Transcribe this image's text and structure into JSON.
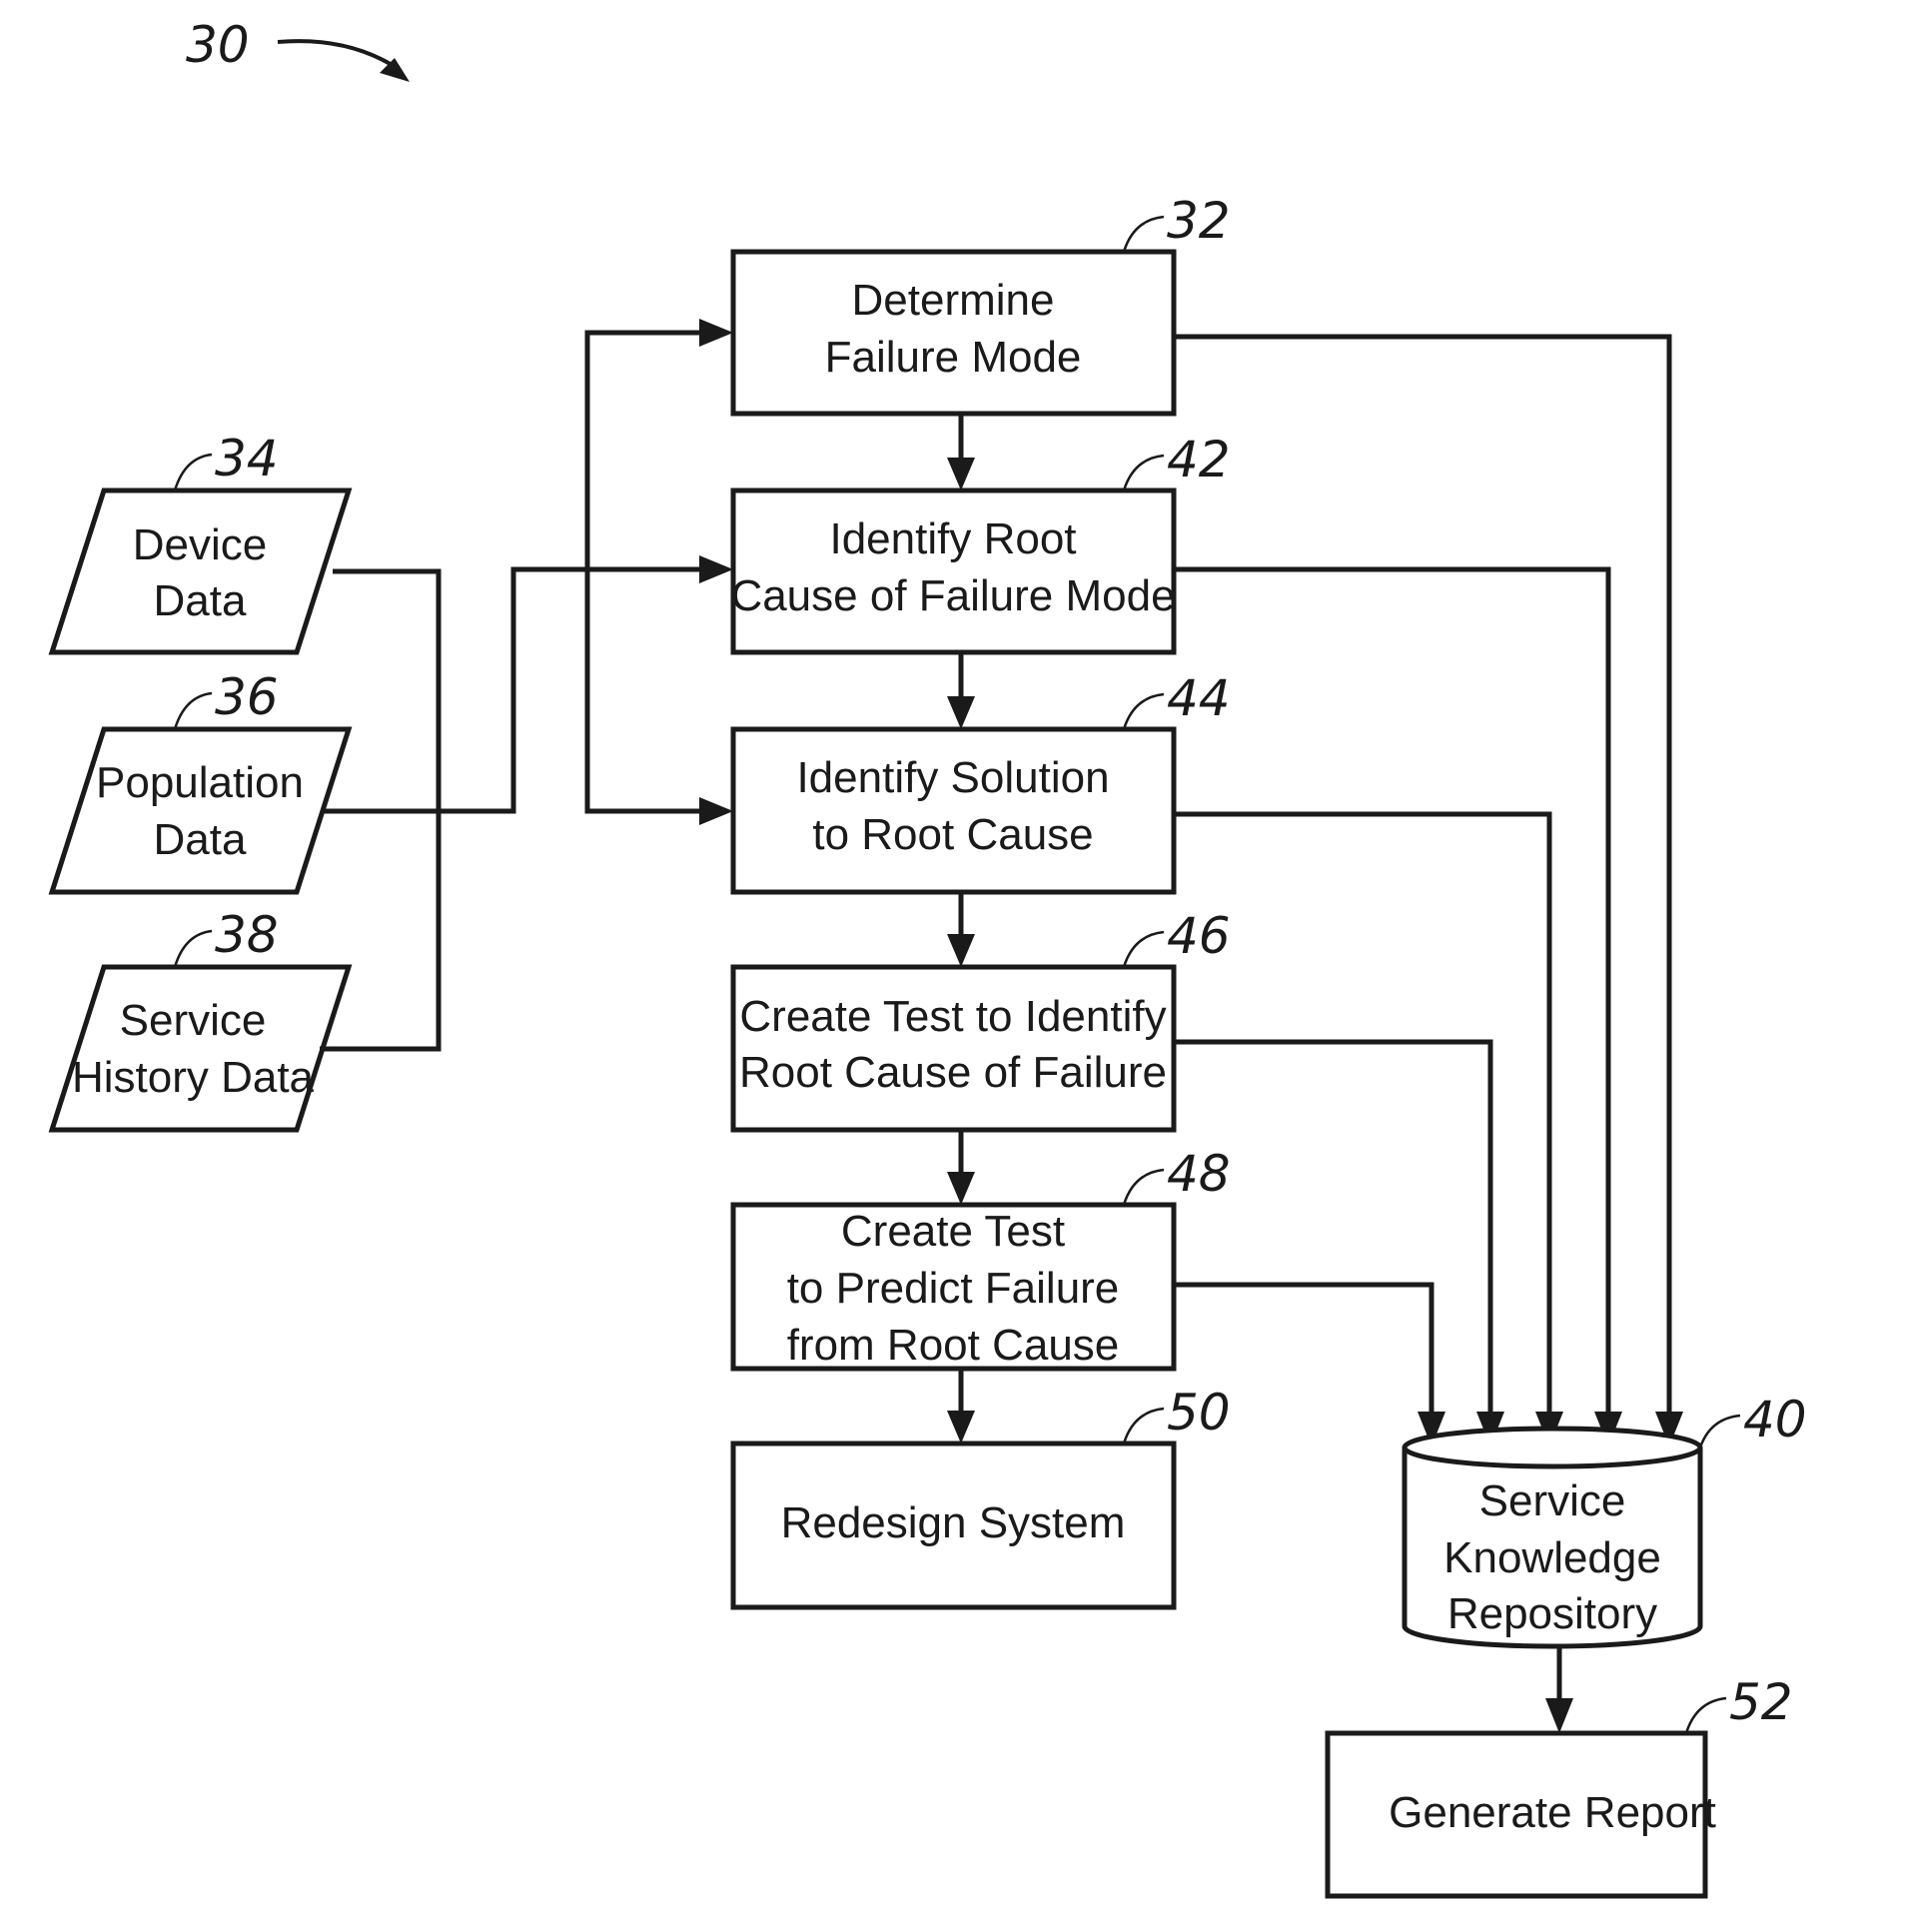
{
  "figure": {
    "ref": "30",
    "nodes": {
      "device_data": {
        "ref": "34",
        "lines": [
          "Device",
          "Data"
        ],
        "shape": "parallelogram"
      },
      "population_data": {
        "ref": "36",
        "lines": [
          "Population",
          "Data"
        ],
        "shape": "parallelogram"
      },
      "service_history_data": {
        "ref": "38",
        "lines": [
          "Service",
          "History Data"
        ],
        "shape": "parallelogram"
      },
      "determine_failure_mode": {
        "ref": "32",
        "lines": [
          "Determine",
          "Failure Mode"
        ],
        "shape": "process"
      },
      "identify_root_cause": {
        "ref": "42",
        "lines": [
          "Identify Root",
          "Cause of Failure Mode"
        ],
        "shape": "process"
      },
      "identify_solution": {
        "ref": "44",
        "lines": [
          "Identify Solution",
          "to Root Cause"
        ],
        "shape": "process"
      },
      "create_test_identify": {
        "ref": "46",
        "lines": [
          "Create Test to Identify",
          "Root Cause of Failure"
        ],
        "shape": "process"
      },
      "create_test_predict": {
        "ref": "48",
        "lines": [
          "Create Test",
          "to Predict Failure",
          "from Root Cause"
        ],
        "shape": "process"
      },
      "redesign_system": {
        "ref": "50",
        "lines": [
          "Redesign System"
        ],
        "shape": "process"
      },
      "service_knowledge_repository": {
        "ref": "40",
        "lines": [
          "Service",
          "Knowledge",
          "Repository"
        ],
        "shape": "database"
      },
      "generate_report": {
        "ref": "52",
        "lines": [
          "Generate Report"
        ],
        "shape": "process"
      }
    },
    "edges": [
      {
        "from": "device_data",
        "to": "identify_root_cause"
      },
      {
        "from": "population_data",
        "to": "identify_root_cause"
      },
      {
        "from": "service_history_data",
        "to": "identify_root_cause"
      },
      {
        "from": "identify_root_cause",
        "to": "determine_failure_mode",
        "via": "bus"
      },
      {
        "from": "identify_root_cause",
        "to": "identify_solution",
        "via": "bus"
      },
      {
        "from": "determine_failure_mode",
        "to": "identify_root_cause"
      },
      {
        "from": "identify_root_cause",
        "to": "identify_solution"
      },
      {
        "from": "identify_solution",
        "to": "create_test_identify"
      },
      {
        "from": "create_test_identify",
        "to": "create_test_predict"
      },
      {
        "from": "create_test_predict",
        "to": "redesign_system"
      },
      {
        "from": "determine_failure_mode",
        "to": "service_knowledge_repository"
      },
      {
        "from": "identify_root_cause",
        "to": "service_knowledge_repository"
      },
      {
        "from": "identify_solution",
        "to": "service_knowledge_repository"
      },
      {
        "from": "create_test_identify",
        "to": "service_knowledge_repository"
      },
      {
        "from": "create_test_predict",
        "to": "service_knowledge_repository"
      },
      {
        "from": "service_knowledge_repository",
        "to": "generate_report"
      }
    ]
  }
}
